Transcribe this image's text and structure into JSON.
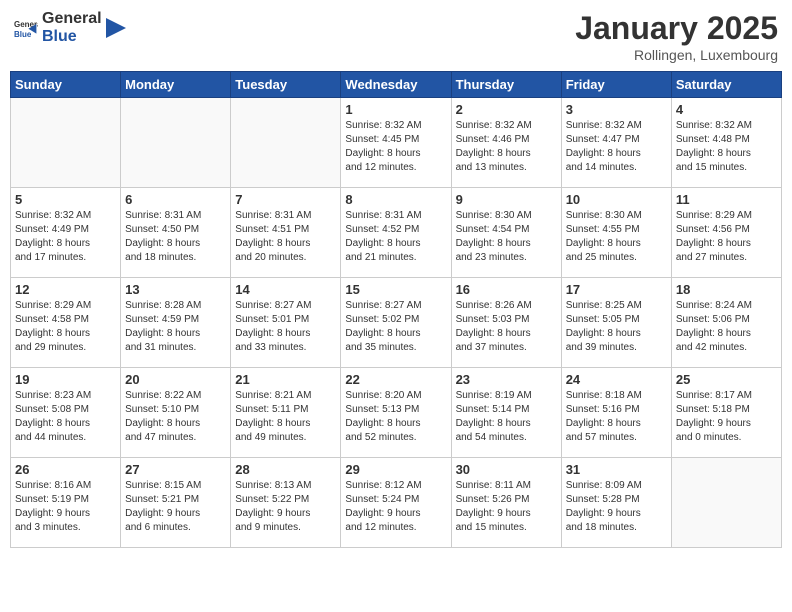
{
  "header": {
    "logo_general": "General",
    "logo_blue": "Blue",
    "month_title": "January 2025",
    "location": "Rollingen, Luxembourg"
  },
  "weekdays": [
    "Sunday",
    "Monday",
    "Tuesday",
    "Wednesday",
    "Thursday",
    "Friday",
    "Saturday"
  ],
  "weeks": [
    [
      {
        "day": "",
        "info": ""
      },
      {
        "day": "",
        "info": ""
      },
      {
        "day": "",
        "info": ""
      },
      {
        "day": "1",
        "info": "Sunrise: 8:32 AM\nSunset: 4:45 PM\nDaylight: 8 hours\nand 12 minutes."
      },
      {
        "day": "2",
        "info": "Sunrise: 8:32 AM\nSunset: 4:46 PM\nDaylight: 8 hours\nand 13 minutes."
      },
      {
        "day": "3",
        "info": "Sunrise: 8:32 AM\nSunset: 4:47 PM\nDaylight: 8 hours\nand 14 minutes."
      },
      {
        "day": "4",
        "info": "Sunrise: 8:32 AM\nSunset: 4:48 PM\nDaylight: 8 hours\nand 15 minutes."
      }
    ],
    [
      {
        "day": "5",
        "info": "Sunrise: 8:32 AM\nSunset: 4:49 PM\nDaylight: 8 hours\nand 17 minutes."
      },
      {
        "day": "6",
        "info": "Sunrise: 8:31 AM\nSunset: 4:50 PM\nDaylight: 8 hours\nand 18 minutes."
      },
      {
        "day": "7",
        "info": "Sunrise: 8:31 AM\nSunset: 4:51 PM\nDaylight: 8 hours\nand 20 minutes."
      },
      {
        "day": "8",
        "info": "Sunrise: 8:31 AM\nSunset: 4:52 PM\nDaylight: 8 hours\nand 21 minutes."
      },
      {
        "day": "9",
        "info": "Sunrise: 8:30 AM\nSunset: 4:54 PM\nDaylight: 8 hours\nand 23 minutes."
      },
      {
        "day": "10",
        "info": "Sunrise: 8:30 AM\nSunset: 4:55 PM\nDaylight: 8 hours\nand 25 minutes."
      },
      {
        "day": "11",
        "info": "Sunrise: 8:29 AM\nSunset: 4:56 PM\nDaylight: 8 hours\nand 27 minutes."
      }
    ],
    [
      {
        "day": "12",
        "info": "Sunrise: 8:29 AM\nSunset: 4:58 PM\nDaylight: 8 hours\nand 29 minutes."
      },
      {
        "day": "13",
        "info": "Sunrise: 8:28 AM\nSunset: 4:59 PM\nDaylight: 8 hours\nand 31 minutes."
      },
      {
        "day": "14",
        "info": "Sunrise: 8:27 AM\nSunset: 5:01 PM\nDaylight: 8 hours\nand 33 minutes."
      },
      {
        "day": "15",
        "info": "Sunrise: 8:27 AM\nSunset: 5:02 PM\nDaylight: 8 hours\nand 35 minutes."
      },
      {
        "day": "16",
        "info": "Sunrise: 8:26 AM\nSunset: 5:03 PM\nDaylight: 8 hours\nand 37 minutes."
      },
      {
        "day": "17",
        "info": "Sunrise: 8:25 AM\nSunset: 5:05 PM\nDaylight: 8 hours\nand 39 minutes."
      },
      {
        "day": "18",
        "info": "Sunrise: 8:24 AM\nSunset: 5:06 PM\nDaylight: 8 hours\nand 42 minutes."
      }
    ],
    [
      {
        "day": "19",
        "info": "Sunrise: 8:23 AM\nSunset: 5:08 PM\nDaylight: 8 hours\nand 44 minutes."
      },
      {
        "day": "20",
        "info": "Sunrise: 8:22 AM\nSunset: 5:10 PM\nDaylight: 8 hours\nand 47 minutes."
      },
      {
        "day": "21",
        "info": "Sunrise: 8:21 AM\nSunset: 5:11 PM\nDaylight: 8 hours\nand 49 minutes."
      },
      {
        "day": "22",
        "info": "Sunrise: 8:20 AM\nSunset: 5:13 PM\nDaylight: 8 hours\nand 52 minutes."
      },
      {
        "day": "23",
        "info": "Sunrise: 8:19 AM\nSunset: 5:14 PM\nDaylight: 8 hours\nand 54 minutes."
      },
      {
        "day": "24",
        "info": "Sunrise: 8:18 AM\nSunset: 5:16 PM\nDaylight: 8 hours\nand 57 minutes."
      },
      {
        "day": "25",
        "info": "Sunrise: 8:17 AM\nSunset: 5:18 PM\nDaylight: 9 hours\nand 0 minutes."
      }
    ],
    [
      {
        "day": "26",
        "info": "Sunrise: 8:16 AM\nSunset: 5:19 PM\nDaylight: 9 hours\nand 3 minutes."
      },
      {
        "day": "27",
        "info": "Sunrise: 8:15 AM\nSunset: 5:21 PM\nDaylight: 9 hours\nand 6 minutes."
      },
      {
        "day": "28",
        "info": "Sunrise: 8:13 AM\nSunset: 5:22 PM\nDaylight: 9 hours\nand 9 minutes."
      },
      {
        "day": "29",
        "info": "Sunrise: 8:12 AM\nSunset: 5:24 PM\nDaylight: 9 hours\nand 12 minutes."
      },
      {
        "day": "30",
        "info": "Sunrise: 8:11 AM\nSunset: 5:26 PM\nDaylight: 9 hours\nand 15 minutes."
      },
      {
        "day": "31",
        "info": "Sunrise: 8:09 AM\nSunset: 5:28 PM\nDaylight: 9 hours\nand 18 minutes."
      },
      {
        "day": "",
        "info": ""
      }
    ]
  ]
}
